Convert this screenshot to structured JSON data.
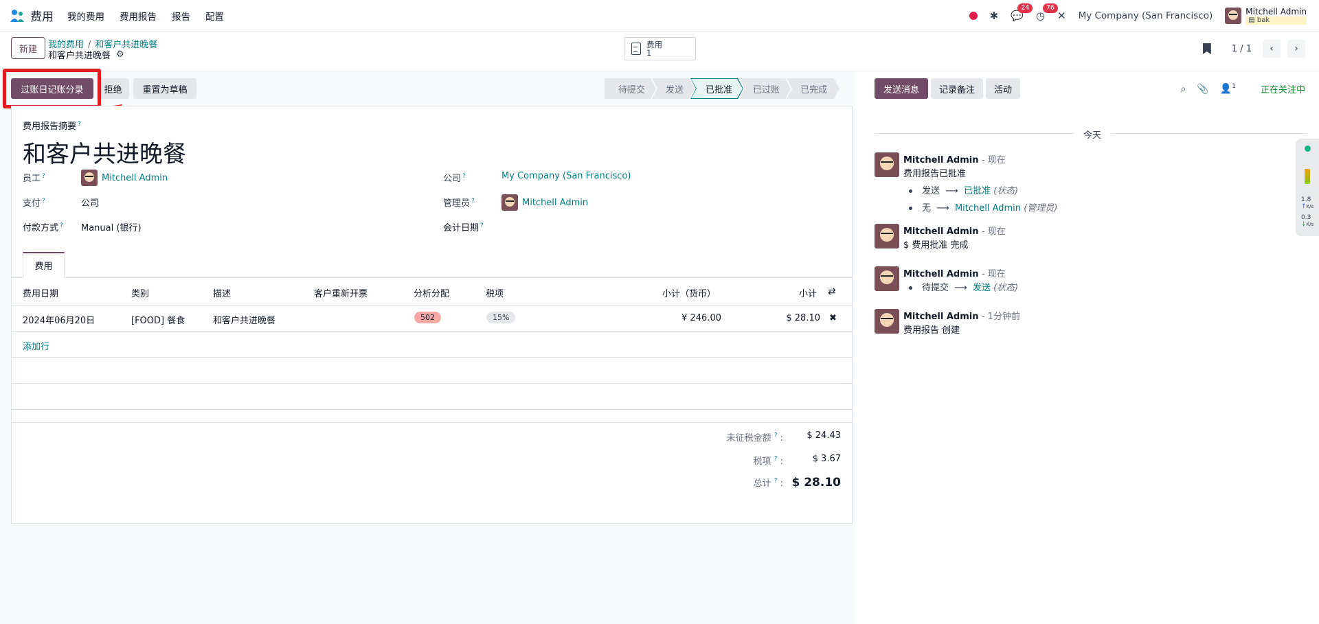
{
  "nav": {
    "app_name": "费用",
    "menu": [
      "我的费用",
      "费用报告",
      "报告",
      "配置"
    ],
    "messages_count": "24",
    "activities_count": "76",
    "company": "My Company (San Francisco)",
    "user_name": "Mitchell Admin",
    "db_name": "bak"
  },
  "control": {
    "new_label": "新建",
    "breadcrumb": [
      "我的费用",
      "和客户共进晚餐"
    ],
    "record_title": "和客户共进晚餐",
    "smart_button": {
      "label": "费用",
      "count": "1"
    },
    "pager": "1 / 1"
  },
  "header_buttons": {
    "post_entries": "过账日记账分录",
    "refuse": "拒绝",
    "reset_draft": "重置为草稿"
  },
  "stages": [
    "待提交",
    "发送",
    "已批准",
    "已过账",
    "已完成"
  ],
  "active_stage": "已批准",
  "form": {
    "summary_label": "费用报告摘要",
    "summary_value": "和客户共进晚餐",
    "employee_label": "员工",
    "employee_value": "Mitchell Admin",
    "paid_by_label": "支付",
    "paid_by_value": "公司",
    "payment_method_label": "付款方式",
    "payment_method_value": "Manual (银行)",
    "company_label": "公司",
    "company_value": "My Company (San Francisco)",
    "manager_label": "管理员",
    "manager_value": "Mitchell Admin",
    "accounting_date_label": "会计日期",
    "tab_label": "费用"
  },
  "table": {
    "headers": [
      "费用日期",
      "类别",
      "描述",
      "客户重新开票",
      "分析分配",
      "税项",
      "小计（货币）",
      "小计"
    ],
    "rows": [
      {
        "date": "2024年06月20日",
        "category": "[FOOD] 餐食",
        "description": "和客户共进晚餐",
        "analytic": "502",
        "tax": "15%",
        "subtotal_currency": "¥ 246.00",
        "subtotal": "$ 28.10"
      }
    ],
    "add_line": "添加行"
  },
  "totals": {
    "untaxed_label": "未征税金额",
    "untaxed_value": "$ 24.43",
    "tax_label": "税项",
    "tax_value": "$ 3.67",
    "total_label": "总计",
    "total_value": "$ 28.10"
  },
  "chatter": {
    "send_message": "发送消息",
    "log_note": "记录备注",
    "activities": "活动",
    "followers_count": "1",
    "following": "正在关注中",
    "day": "今天",
    "messages": [
      {
        "author": "Mitchell Admin",
        "date": "- 现在",
        "body": "费用报告已批准",
        "changes": [
          {
            "from": "发送",
            "to": "已批准",
            "field": "(状态)"
          },
          {
            "from": "无",
            "to": "Mitchell Admin",
            "field": "(管理员)"
          }
        ]
      },
      {
        "author": "Mitchell Admin",
        "date": "- 现在",
        "body": "$ 费用批准 完成"
      },
      {
        "author": "Mitchell Admin",
        "date": "- 现在",
        "changes": [
          {
            "from": "待提交",
            "to": "发送",
            "field": "(状态)"
          }
        ]
      },
      {
        "author": "Mitchell Admin",
        "date": "- 1分钟前",
        "body": "费用报告 创建"
      }
    ]
  },
  "widget": {
    "up_speed": "1.8",
    "down_speed": "0.3",
    "unit": "K/s"
  },
  "colors": {
    "brand": "#714b67",
    "link": "#017e84",
    "annotation": "#e11d24"
  }
}
